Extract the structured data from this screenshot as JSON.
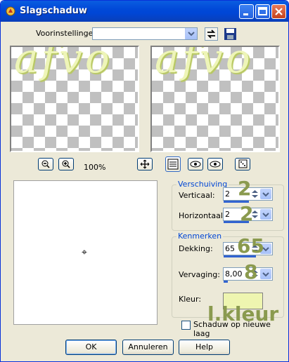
{
  "window": {
    "title": "Slagschaduw"
  },
  "presets": {
    "label": "Voorinstellingen:",
    "selected": ""
  },
  "preview": {
    "text": "afvo",
    "zoom": "100%"
  },
  "offset": {
    "legend": "Verschuiving",
    "vertical_label": "Verticaal:",
    "vertical_value": "2",
    "horizontal_label": "Horizontaal:",
    "horizontal_value": "2"
  },
  "properties": {
    "legend": "Kenmerken",
    "opacity_label": "Dekking:",
    "opacity_value": "65",
    "blur_label": "Vervaging:",
    "blur_value": "8,00",
    "color_label": "Kleur:",
    "color": "#eef5b0"
  },
  "annotations": {
    "vertical": "2",
    "horizontal": "2",
    "opacity": "65",
    "blur": "8",
    "color": "l.kleur"
  },
  "checkbox": {
    "label": "Schaduw op nieuwe laag",
    "checked": false
  },
  "buttons": {
    "ok": "OK",
    "cancel": "Annuleren",
    "help": "Help"
  }
}
